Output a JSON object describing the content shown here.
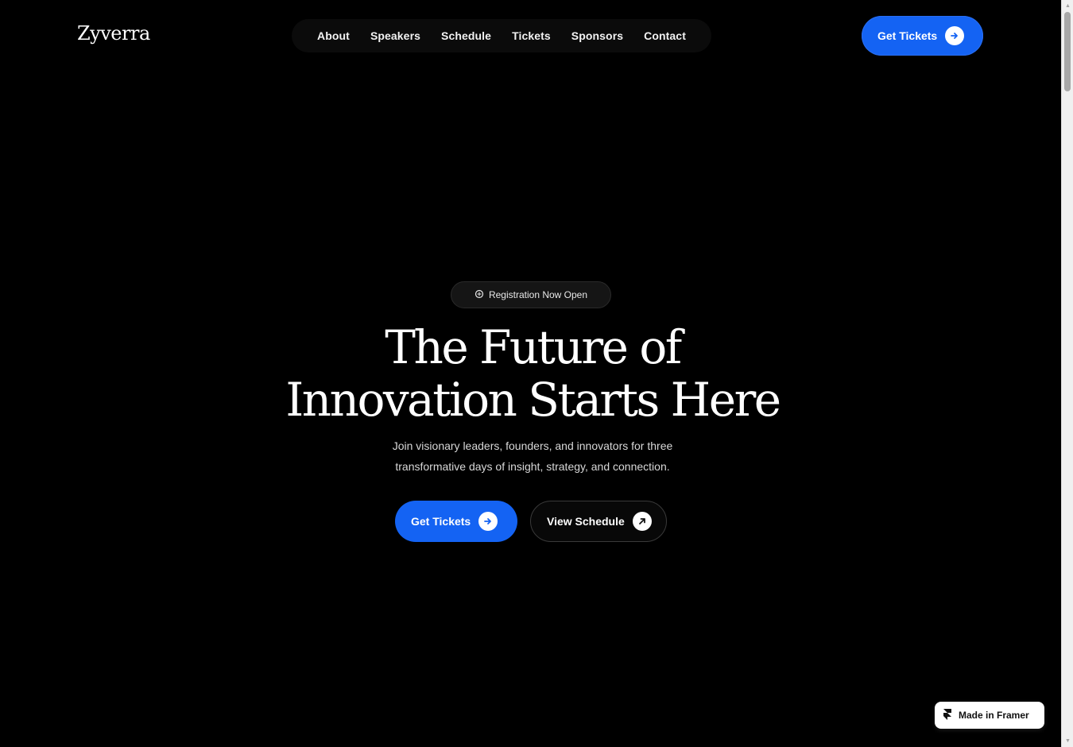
{
  "header": {
    "logo": "Zyverra",
    "nav": [
      {
        "label": "About"
      },
      {
        "label": "Speakers"
      },
      {
        "label": "Schedule"
      },
      {
        "label": "Tickets"
      },
      {
        "label": "Sponsors"
      },
      {
        "label": "Contact"
      }
    ],
    "cta_label": "Get Tickets",
    "cta_icon": "arrow-right-icon"
  },
  "hero": {
    "badge": "Registration Now Open",
    "badge_icon": "sparkle-icon",
    "title_line1": "The Future of",
    "title_line2": "Innovation Starts Here",
    "subtitle_line1": "Join visionary leaders, founders, and innovators for three",
    "subtitle_line2": "transformative days of insight, strategy, and connection.",
    "primary_label": "Get Tickets",
    "secondary_label": "View Schedule"
  },
  "framer_badge": {
    "label": "Made in Framer"
  },
  "colors": {
    "background": "#000000",
    "accent": "#1463f3",
    "text": "#ffffff"
  }
}
